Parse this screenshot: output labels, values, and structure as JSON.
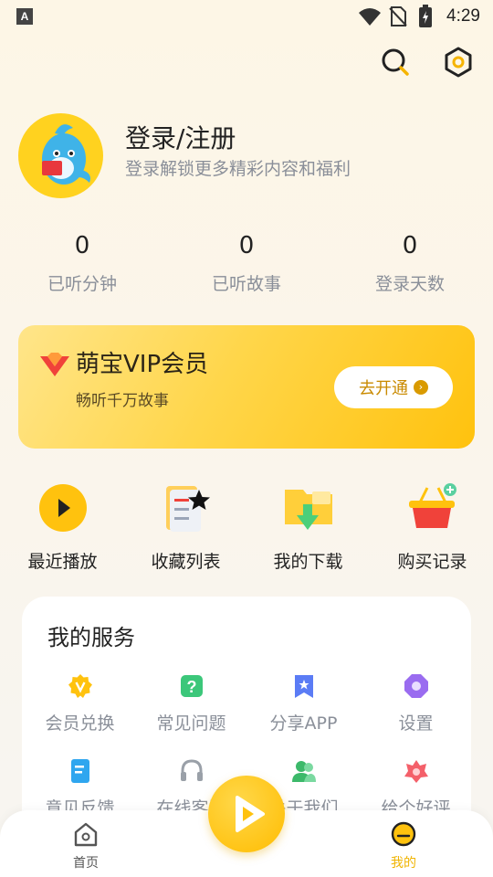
{
  "status_bar": {
    "left_icon_letter": "A",
    "time": "4:29"
  },
  "top_actions": {
    "search_icon": "search-icon",
    "settings_icon": "hexagon-settings-icon"
  },
  "profile": {
    "title": "登录/注册",
    "subtitle": "登录解锁更多精彩内容和福利"
  },
  "stats": [
    {
      "value": "0",
      "label": "已听分钟"
    },
    {
      "value": "0",
      "label": "已听故事"
    },
    {
      "value": "0",
      "label": "登录天数"
    }
  ],
  "vip": {
    "title": "萌宝VIP会员",
    "subtitle": "畅听千万故事",
    "button_label": "去开通"
  },
  "quick_actions": [
    {
      "label": "最近播放",
      "icon": "play-circle-icon"
    },
    {
      "label": "收藏列表",
      "icon": "favorites-list-icon"
    },
    {
      "label": "我的下载",
      "icon": "download-folder-icon"
    },
    {
      "label": "购买记录",
      "icon": "shopping-basket-icon"
    }
  ],
  "services": {
    "title": "我的服务",
    "items": [
      {
        "label": "会员兑换",
        "icon": "vip-badge-icon"
      },
      {
        "label": "常见问题",
        "icon": "question-icon"
      },
      {
        "label": "分享APP",
        "icon": "share-bookmark-icon"
      },
      {
        "label": "设置",
        "icon": "settings-octagon-icon"
      },
      {
        "label": "意见反馈",
        "icon": "feedback-doc-icon"
      },
      {
        "label": "在线客服",
        "icon": "headset-icon"
      },
      {
        "label": "关于我们",
        "icon": "about-people-icon"
      },
      {
        "label": "给个好评",
        "icon": "flower-rating-icon"
      }
    ]
  },
  "bottom_nav": {
    "home_label": "首页",
    "mine_label": "我的"
  },
  "colors": {
    "accent": "#ffc20e",
    "active_nav": "#f0b400",
    "muted_text": "#8a8f99"
  }
}
